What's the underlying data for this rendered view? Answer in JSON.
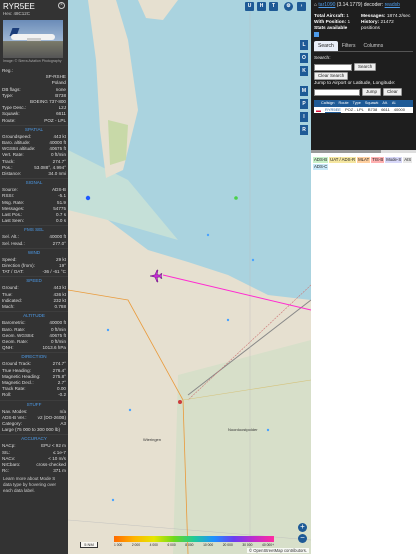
{
  "info": {
    "callsign": "RYR5EE",
    "hex_label": "Hex:",
    "hex": "48C12C",
    "photo_credit": "Image: © Sierra Aviation Photography",
    "rows1": [
      {
        "k": "Reg.:",
        "v": ""
      },
      {
        "k": "",
        "v": "SP-RSHE"
      },
      {
        "k": "",
        "v": "Poland"
      },
      {
        "k": "DB flags:",
        "v": "none"
      },
      {
        "k": "Type:",
        "v": "B738"
      },
      {
        "k": "",
        "v": "BOEING 737-800"
      },
      {
        "k": "Type Desc.:",
        "v": "L2J"
      },
      {
        "k": "Squawk:",
        "v": "6611"
      },
      {
        "k": "Route:",
        "v": "POZ - LPL"
      }
    ],
    "spatial_title": "SPATIAL",
    "spatial": [
      {
        "k": "Groundspeed:",
        "v": "443 kt"
      },
      {
        "k": "Baro. altitude:",
        "v": "40000 ft"
      },
      {
        "k": "WGS84 altitude:",
        "v": "40675 ft"
      },
      {
        "k": "Vert. Rate:",
        "v": "0 ft/min"
      },
      {
        "k": "Track:",
        "v": "274.7°"
      },
      {
        "k": "Pos.:",
        "v": "53.088°, 4.994°"
      },
      {
        "k": "Distance:",
        "v": "34.0 nmi"
      }
    ],
    "signal_title": "SIGNAL",
    "signal": [
      {
        "k": "Source:",
        "v": "ADS-B"
      },
      {
        "k": "RSSI:",
        "v": "-5.1"
      },
      {
        "k": "Msg. Rate:",
        "v": "51.9"
      },
      {
        "k": "Messages:",
        "v": "54775"
      },
      {
        "k": "Last Pos.:",
        "v": "0.7 s"
      },
      {
        "k": "Last Seen:",
        "v": "0.0 s"
      }
    ],
    "fms_title": "FMS SEL",
    "fms": [
      {
        "k": "Sel. Alt.:",
        "v": "40000 ft"
      },
      {
        "k": "Sel. Head.:",
        "v": "277.0°"
      }
    ],
    "wind_title": "WIND",
    "wind": [
      {
        "k": "Speed:",
        "v": "29 kt"
      },
      {
        "k": "Direction (from):",
        "v": "19°"
      },
      {
        "k": "TAT / OAT:",
        "v": "-36 / -61 °C"
      }
    ],
    "speed_title": "SPEED",
    "speed": [
      {
        "k": "Ground:",
        "v": "443 kt"
      },
      {
        "k": "True:",
        "v": "436 kt"
      },
      {
        "k": "Indicated:",
        "v": "232 kt"
      },
      {
        "k": "Mach:",
        "v": "0.788"
      }
    ],
    "altitude_title": "ALTITUDE",
    "altitude": [
      {
        "k": "Barometric:",
        "v": "40000 ft"
      },
      {
        "k": "Baro. Rate:",
        "v": "0 ft/min"
      },
      {
        "k": "Geom. WGS84:",
        "v": "40675 ft"
      },
      {
        "k": "Geom. Rate:",
        "v": "0 ft/min"
      },
      {
        "k": "QNH:",
        "v": "1013.6 hPa"
      }
    ],
    "direction_title": "DIRECTION",
    "direction": [
      {
        "k": "Ground Track:",
        "v": "274.7°"
      },
      {
        "k": "True Heading:",
        "v": "276.4°"
      },
      {
        "k": "Magnetic Heading:",
        "v": "275.8°"
      },
      {
        "k": "Magnetic Decl.:",
        "v": "2.7°"
      },
      {
        "k": "Track Rate:",
        "v": "0.00"
      },
      {
        "k": "Roll:",
        "v": "-0.2"
      }
    ],
    "stuff_title": "STUFF",
    "stuff": [
      {
        "k": "Nav. Modes:",
        "v": "n/a"
      },
      {
        "k": "ADS-B Ver.:",
        "v": "v2 (DO-260B)"
      },
      {
        "k": "Category:",
        "v": "A3"
      },
      {
        "k": "Large (75 000 to 300 000 lb)",
        "v": ""
      }
    ],
    "accuracy_title": "ACCURACY",
    "accuracy": [
      {
        "k": "NACp:",
        "v": "EPU < 92 m"
      },
      {
        "k": "SIL:",
        "v": "≤ 1e-7"
      },
      {
        "k": "NACv:",
        "v": "< 10 m/s"
      },
      {
        "k": "NICbaro:",
        "v": "cross-checked"
      },
      {
        "k": "Rc:",
        "v": "371 m"
      }
    ],
    "footer": "Learn more about Mode S data type by hovering over each data label."
  },
  "map": {
    "top_buttons": [
      "U",
      "H",
      "T"
    ],
    "side_buttons": [
      "L",
      "O",
      "K",
      "M",
      "P",
      "I",
      "R"
    ],
    "zoom_in": "+",
    "zoom_out": "−",
    "scale": "5 NM",
    "altitude_labels": [
      "1 000",
      "2 000",
      "4 000",
      "6 000",
      "8 000",
      "10 000",
      "20 000",
      "30 000",
      "40 000+"
    ],
    "attribution": "© OpenStreetMap contributors.",
    "place_labels": [
      "Wieringen",
      "Noordoostpolder"
    ]
  },
  "panel": {
    "title_link": "tar1090",
    "title_rest": "(3.14.1779) decoder:",
    "title_link2": "readsb",
    "stats_left": [
      {
        "label": "Total Aircraft:",
        "value": "1"
      },
      {
        "label": "With Position:",
        "value": "1"
      },
      {
        "label": "Stats available",
        "value": ""
      }
    ],
    "stats_right": [
      {
        "label": "Messages:",
        "value": "1874.2/sec"
      },
      {
        "label": "History:",
        "value": "21472 positions"
      }
    ],
    "tabs": [
      "Search",
      "Filters",
      "Columns"
    ],
    "search_label": "Search:",
    "search_button": "Search",
    "clear_search": "Clear Search",
    "jump_label": "Jump to Airport or Latitude, Longitude:",
    "jump_button": "Jump",
    "clear_button": "Clear",
    "columns": [
      "Callsign",
      "Route",
      "Type",
      "Squawk",
      "Alt.",
      "Al."
    ],
    "row": {
      "callsign": "RYR5EE",
      "route": "POZ - LPL",
      "type": "B738",
      "squawk": "6611",
      "alt": "40000"
    },
    "legend": [
      {
        "label": "ADS-B",
        "color": "#c8f0c8"
      },
      {
        "label": "UAT / ADS-R",
        "color": "#f5e6a0"
      },
      {
        "label": "MLAT",
        "color": "#ffd0a0"
      },
      {
        "label": "TIS-B",
        "color": "#ffb0b0"
      },
      {
        "label": "Mode-S",
        "color": "#d8d8f8"
      },
      {
        "label": "AIS",
        "color": "#e8e8e8"
      },
      {
        "label": "ADS-C",
        "color": "#c8e8f8"
      }
    ]
  },
  "colors": {
    "accent": "#1e5a96",
    "track": "#ff2bd1",
    "sea": "#aad3df",
    "land": "#e5e0d4"
  }
}
